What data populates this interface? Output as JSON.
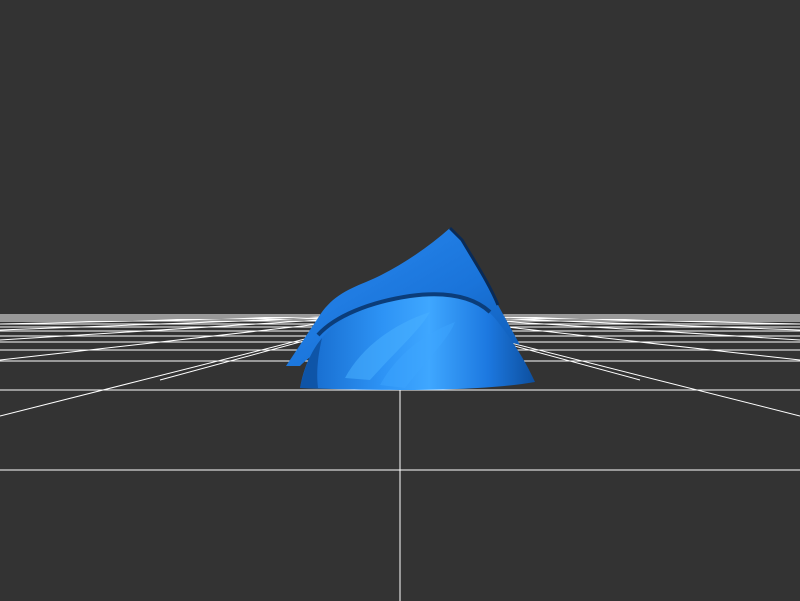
{
  "viewport": {
    "background_color": "#333333",
    "grid_color": "#ffffff",
    "model_color": "#1e7de8",
    "model_highlight_color": "#3fa7ff",
    "model_shadow_color": "#0b3d7a",
    "model_edge_color": "#0a2a55"
  }
}
